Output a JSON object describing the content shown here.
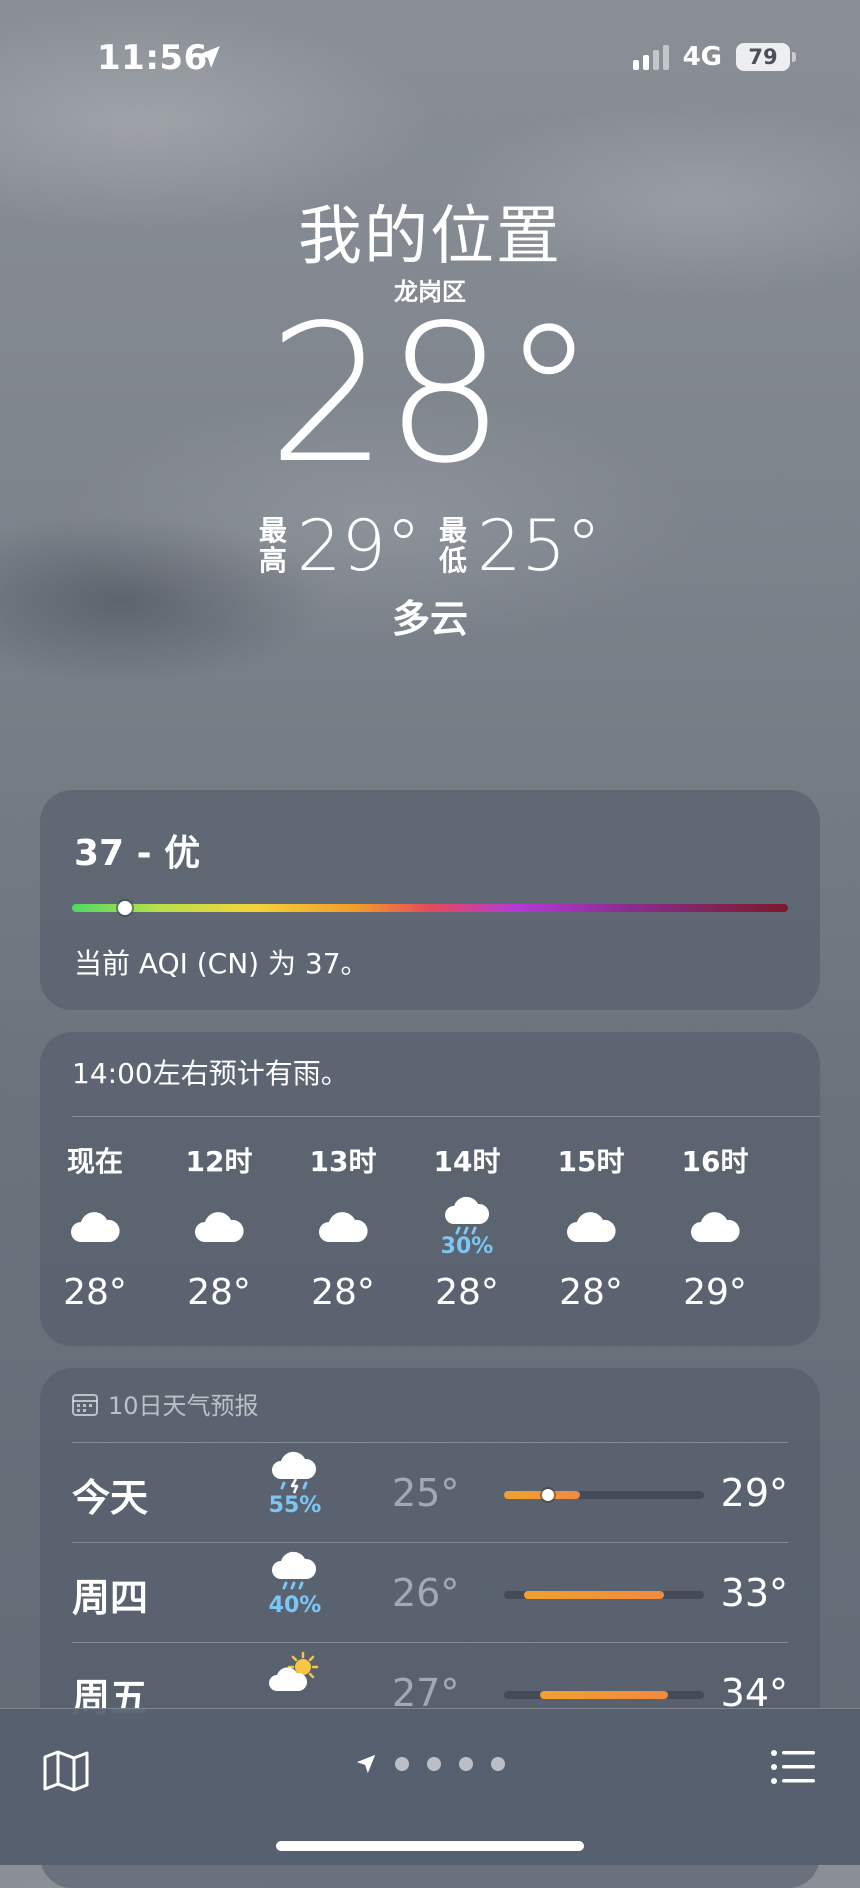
{
  "status": {
    "time": "11:56",
    "network": "4G",
    "battery": "79"
  },
  "location": {
    "title": "我的位置",
    "district": "龙岗区"
  },
  "current": {
    "temp": "28°",
    "high_label": "最高",
    "high": "29°",
    "low_label": "最低",
    "low": "25°",
    "condition": "多云"
  },
  "aqi": {
    "title": "37 - 优",
    "value": 37,
    "description": "当前 AQI (CN) 为 37。"
  },
  "hourly": {
    "note": "14:00左右预计有雨。",
    "items": [
      {
        "label": "现在",
        "icon": "cloud-icon",
        "pct": "",
        "temp": "28°"
      },
      {
        "label": "12时",
        "icon": "cloud-icon",
        "pct": "",
        "temp": "28°"
      },
      {
        "label": "13时",
        "icon": "cloud-icon",
        "pct": "",
        "temp": "28°"
      },
      {
        "label": "14时",
        "icon": "cloud-rain-icon",
        "pct": "30%",
        "temp": "28°"
      },
      {
        "label": "15时",
        "icon": "cloud-icon",
        "pct": "",
        "temp": "28°"
      },
      {
        "label": "16时",
        "icon": "cloud-icon",
        "pct": "",
        "temp": "29°"
      }
    ]
  },
  "daily": {
    "header": "10日天气预报",
    "days": [
      {
        "name": "今天",
        "icon": "thunderstorm-rain-icon",
        "pct": "55%",
        "low": "25°",
        "high": "29°",
        "bar_start": 0.0,
        "bar_end": 0.38,
        "current_pos": 0.22
      },
      {
        "name": "周四",
        "icon": "cloud-rain-icon",
        "pct": "40%",
        "low": "26°",
        "high": "33°",
        "bar_start": 0.1,
        "bar_end": 0.8
      },
      {
        "name": "周五",
        "icon": "partly-sunny-icon",
        "pct": "",
        "low": "27°",
        "high": "34°",
        "bar_start": 0.18,
        "bar_end": 0.82
      }
    ]
  },
  "colors": {
    "precip": "#7cc6f5",
    "temp_bar": "#f0a030"
  }
}
